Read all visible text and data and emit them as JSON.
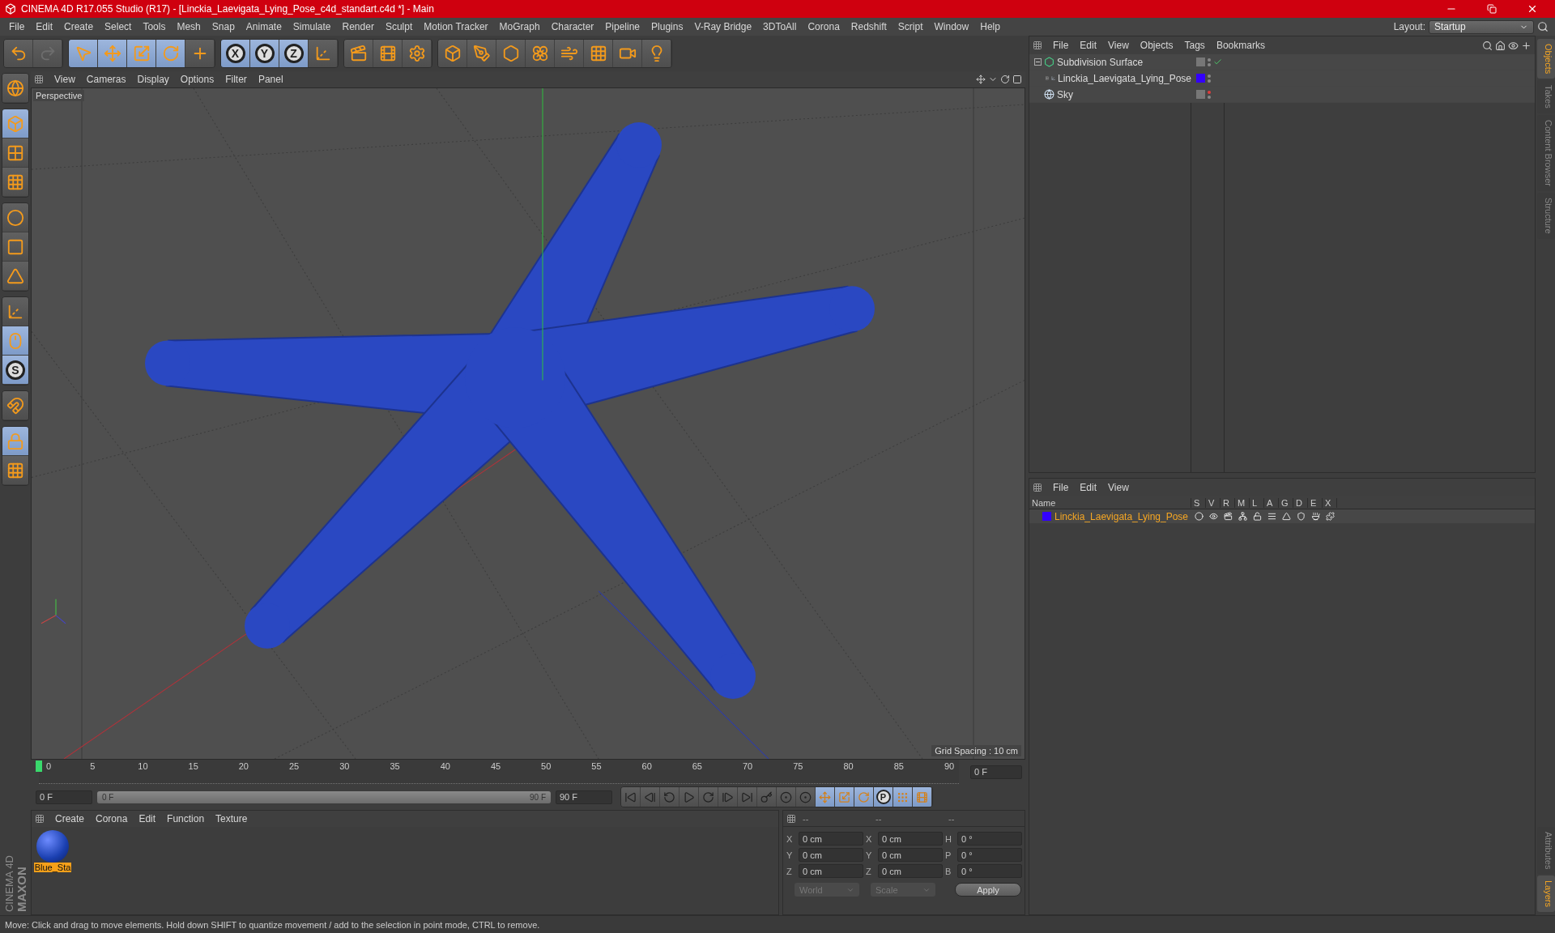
{
  "window": {
    "title": "CINEMA 4D R17.055 Studio (R17) - [Linckia_Laevigata_Lying_Pose_c4d_standart.c4d *] - Main"
  },
  "menu": [
    "File",
    "Edit",
    "Create",
    "Select",
    "Tools",
    "Mesh",
    "Snap",
    "Animate",
    "Simulate",
    "Render",
    "Sculpt",
    "Motion Tracker",
    "MoGraph",
    "Character",
    "Pipeline",
    "Plugins",
    "V-Ray Bridge",
    "3DToAll",
    "Corona",
    "Redshift",
    "Script",
    "Window",
    "Help"
  ],
  "layout": {
    "label": "Layout:",
    "value": "Startup"
  },
  "toolbar": [
    {
      "items": [
        {
          "kind": "undo",
          "selected": false,
          "disabled": false
        },
        {
          "kind": "redo",
          "selected": false,
          "disabled": true
        }
      ]
    },
    {
      "items": [
        {
          "kind": "select",
          "selected": true,
          "disabled": false
        },
        {
          "kind": "move",
          "selected": true,
          "disabled": false
        },
        {
          "kind": "scale",
          "selected": true,
          "disabled": false
        },
        {
          "kind": "rotate",
          "selected": true,
          "disabled": false
        },
        {
          "kind": "add",
          "selected": false,
          "disabled": false
        }
      ]
    },
    {
      "items": [
        {
          "kind": "axis",
          "label": "X",
          "selected": true,
          "disabled": false
        },
        {
          "kind": "axis",
          "label": "Y",
          "selected": true,
          "disabled": false
        },
        {
          "kind": "axis",
          "label": "Z",
          "selected": true,
          "disabled": false
        },
        {
          "kind": "coords",
          "selected": false,
          "disabled": false
        }
      ]
    },
    {
      "items": [
        {
          "kind": "render-view",
          "selected": false,
          "disabled": false
        },
        {
          "kind": "render",
          "selected": false,
          "disabled": false
        },
        {
          "kind": "render-settings",
          "selected": false,
          "disabled": false
        }
      ]
    },
    {
      "items": [
        {
          "kind": "cube",
          "selected": false,
          "disabled": false
        },
        {
          "kind": "pen",
          "selected": false,
          "disabled": false
        },
        {
          "kind": "subdivision",
          "selected": false,
          "disabled": false
        },
        {
          "kind": "cloner",
          "selected": false,
          "disabled": false
        },
        {
          "kind": "deformer",
          "selected": false,
          "disabled": false
        },
        {
          "kind": "floor",
          "selected": false,
          "disabled": false
        },
        {
          "kind": "camera",
          "selected": false,
          "disabled": false
        },
        {
          "kind": "light",
          "selected": false,
          "disabled": false
        }
      ]
    }
  ],
  "tools": [
    {
      "items": [
        {
          "kind": "globe",
          "selected": false
        }
      ]
    },
    {
      "items": [
        {
          "kind": "model",
          "selected": true
        },
        {
          "kind": "texture",
          "selected": false
        },
        {
          "kind": "workplane",
          "selected": false
        }
      ]
    },
    {
      "items": [
        {
          "kind": "points",
          "selected": false
        },
        {
          "kind": "edges",
          "selected": false
        },
        {
          "kind": "polygons",
          "selected": false
        }
      ]
    },
    {
      "items": [
        {
          "kind": "axis-mode",
          "selected": false
        },
        {
          "kind": "tweak",
          "selected": true
        },
        {
          "kind": "snap",
          "label": "S",
          "selected": true
        }
      ]
    },
    {
      "items": [
        {
          "kind": "magnet",
          "selected": false
        }
      ]
    },
    {
      "items": [
        {
          "kind": "lock-plane",
          "selected": true
        },
        {
          "kind": "plane",
          "selected": false
        }
      ]
    }
  ],
  "viewport": {
    "menu": [
      "View",
      "Cameras",
      "Display",
      "Options",
      "Filter",
      "Panel"
    ],
    "camera": "Perspective",
    "grid_spacing": "Grid Spacing : 10 cm"
  },
  "timeline": {
    "ticks": [
      "0",
      "5",
      "10",
      "15",
      "20",
      "25",
      "30",
      "35",
      "40",
      "45",
      "50",
      "55",
      "60",
      "65",
      "70",
      "75",
      "80",
      "85",
      "90"
    ],
    "playhead": {
      "level": 0
    },
    "current_frame": "0 F",
    "start": "0 F",
    "range": {
      "start": "0 F",
      "end": "90 F",
      "level": 1
    },
    "end": "90 F",
    "buttons": [
      {
        "kind": "first",
        "selected": false
      },
      {
        "kind": "prev-key",
        "selected": false
      },
      {
        "kind": "prev-frame",
        "selected": false
      },
      {
        "kind": "play",
        "selected": false
      },
      {
        "kind": "next-frame",
        "selected": false
      },
      {
        "kind": "next-key",
        "selected": false
      },
      {
        "kind": "last",
        "selected": false
      },
      {
        "kind": "keyframe",
        "selected": false
      },
      {
        "kind": "autokey",
        "selected": false
      },
      {
        "kind": "key-select",
        "selected": false
      },
      {
        "kind": "move",
        "selected": true
      },
      {
        "kind": "scale",
        "selected": true
      },
      {
        "kind": "rotate",
        "selected": true
      },
      {
        "kind": "param",
        "label": "P",
        "selected": true
      },
      {
        "kind": "pla",
        "selected": true
      },
      {
        "kind": "film",
        "selected": true
      }
    ]
  },
  "materials": {
    "menu": [
      "Create",
      "Corona",
      "Edit",
      "Function",
      "Texture"
    ],
    "items": [
      {
        "name": "Blue_Sta",
        "selected": true
      }
    ]
  },
  "coordinates": {
    "headers": [
      "--",
      "--",
      "--"
    ],
    "rows": [
      {
        "axes": [
          "X",
          "X",
          "H"
        ],
        "values": [
          "0 cm",
          "0 cm",
          "0 °"
        ]
      },
      {
        "axes": [
          "Y",
          "Y",
          "P"
        ],
        "values": [
          "0 cm",
          "0 cm",
          "0 °"
        ]
      },
      {
        "axes": [
          "Z",
          "Z",
          "B"
        ],
        "values": [
          "0 cm",
          "0 cm",
          "0 °"
        ]
      }
    ],
    "mode": "World",
    "transform": "Scale",
    "apply": "Apply"
  },
  "objects": {
    "menu": [
      "File",
      "Edit",
      "View",
      "Objects",
      "Tags",
      "Bookmarks"
    ],
    "rows": [
      {
        "name": "Subdivision Surface",
        "kind": "subdivision",
        "expanded": true,
        "enabled": true,
        "editor_visible": true,
        "children": [
          {
            "name": "Linckia_Laevigata_Lying_Pose",
            "kind": "null",
            "expanded": false,
            "enabled": false,
            "editor_visible": true,
            "color": "#3300ff"
          }
        ]
      },
      {
        "name": "Sky",
        "kind": "sky",
        "enabled": false,
        "editor_visible": false
      }
    ]
  },
  "layers": {
    "menu": [
      "File",
      "Edit",
      "View"
    ],
    "columns": [
      "Name",
      "S",
      "V",
      "R",
      "M",
      "L",
      "A",
      "G",
      "D",
      "E",
      "X"
    ],
    "rows": [
      {
        "name": "Linckia_Laevigata_Lying_Pose",
        "color": "#3300ff"
      }
    ]
  },
  "side_tabs": {
    "top": [
      {
        "label": "Objects",
        "selected": true
      },
      {
        "label": "Takes",
        "selected": false
      },
      {
        "label": "Content Browser",
        "selected": false
      },
      {
        "label": "Structure",
        "selected": false
      }
    ],
    "bottom": [
      {
        "label": "Attributes",
        "selected": false
      },
      {
        "label": "Layers",
        "selected": true
      }
    ]
  },
  "logo": {
    "brand": "MAXON",
    "product": "CINEMA 4D"
  },
  "status": "Move: Click and drag to move elements. Hold down SHIFT to quantize movement / add to the selection in point mode, CTRL to remove."
}
